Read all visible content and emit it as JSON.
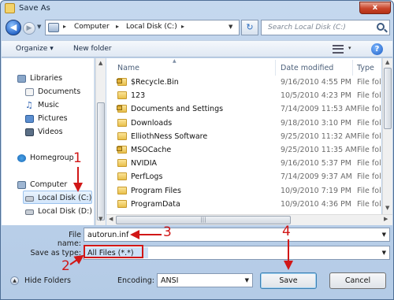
{
  "window": {
    "title": "Save As",
    "close_glyph": "x"
  },
  "address": {
    "crumbs": [
      "Computer",
      "Local Disk (C:)"
    ],
    "search_placeholder": "Search Local Disk (C:)"
  },
  "toolbar": {
    "organize": "Organize",
    "new_folder": "New folder",
    "help": "?"
  },
  "nav": {
    "items": [
      {
        "label": "Libraries",
        "icon": "libraries-icon"
      },
      {
        "label": "Documents",
        "icon": "documents-icon"
      },
      {
        "label": "Music",
        "icon": "music-icon"
      },
      {
        "label": "Pictures",
        "icon": "pictures-icon"
      },
      {
        "label": "Videos",
        "icon": "videos-icon"
      },
      {
        "label": "Homegroup",
        "icon": "homegroup-icon"
      },
      {
        "label": "Computer",
        "icon": "computer-icon"
      },
      {
        "label": "Local Disk (C:)",
        "icon": "drive-icon"
      },
      {
        "label": "Local Disk (D:)",
        "icon": "drive-icon"
      }
    ],
    "selected": "Local Disk (C:)"
  },
  "columns": {
    "name": "Name",
    "date": "Date modified",
    "type": "Type"
  },
  "files": [
    {
      "name": "$Recycle.Bin",
      "date": "9/16/2010 4:55 PM",
      "type": "File fol",
      "locked": true
    },
    {
      "name": "123",
      "date": "10/5/2010 4:23 PM",
      "type": "File fol",
      "locked": false
    },
    {
      "name": "Documents and Settings",
      "date": "7/14/2009 11:53 AM",
      "type": "File fol",
      "locked": true
    },
    {
      "name": "Downloads",
      "date": "9/18/2010 3:10 PM",
      "type": "File fol",
      "locked": false
    },
    {
      "name": "ElliothNess Software",
      "date": "9/25/2010 11:32 AM",
      "type": "File fol",
      "locked": false
    },
    {
      "name": "MSOCache",
      "date": "9/25/2010 11:35 AM",
      "type": "File fol",
      "locked": true
    },
    {
      "name": "NVIDIA",
      "date": "9/16/2010 5:37 PM",
      "type": "File fol",
      "locked": false
    },
    {
      "name": "PerfLogs",
      "date": "7/14/2009 9:37 AM",
      "type": "File fol",
      "locked": false
    },
    {
      "name": "Program Files",
      "date": "10/9/2010 7:19 PM",
      "type": "File fol",
      "locked": false
    },
    {
      "name": "ProgramData",
      "date": "10/9/2010 4:36 PM",
      "type": "File fol",
      "locked": false
    }
  ],
  "form": {
    "file_name_label": "File name:",
    "file_name_value": "autorun.inf",
    "save_type_label": "Save as type:",
    "save_type_value": "All Files  (*.*)",
    "encoding_label": "Encoding:",
    "encoding_value": "ANSI"
  },
  "buttons": {
    "save": "Save",
    "cancel": "Cancel",
    "hide_folders": "Hide Folders"
  },
  "annotations": [
    "1",
    "2",
    "3",
    "4"
  ],
  "colors": {
    "annotation": "#d11717",
    "window_frame": "#b4cbe6",
    "selection": "#d3e6fb"
  }
}
